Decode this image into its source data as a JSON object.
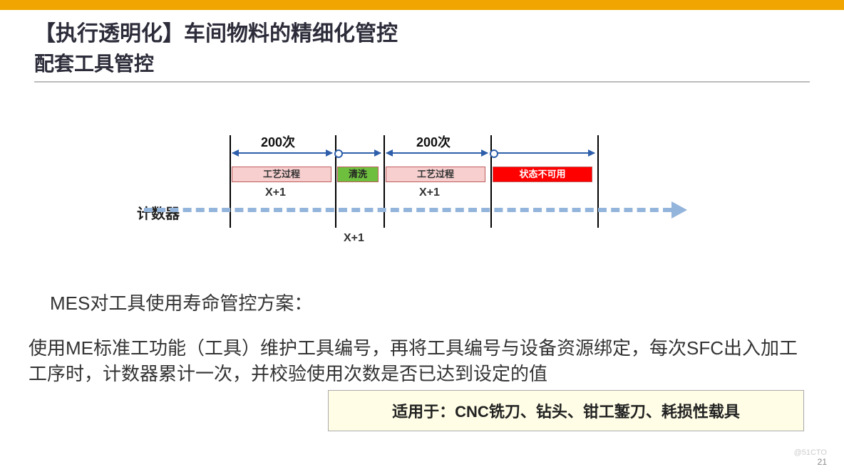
{
  "header": {
    "title_prefix": "【执行透明化】",
    "title_main": "车间物料的精细化管控",
    "subtitle": "配套工具管控"
  },
  "diagram": {
    "counter_label": "计数器",
    "span1_label": "200次",
    "span2_label": "200次",
    "seg_process": "工艺过程",
    "seg_wash": "清洗",
    "seg_unavail": "状态不可用",
    "xplus1": "X+1",
    "xplus2": "X+1",
    "xplus3": "X+1"
  },
  "body": {
    "line1": "MES对工具使用寿命管控方案：",
    "line2": "使用ME标准工功能（工具）维护工具编号，再将工具编号与设备资源绑定，每次SFC出入加工工序时，计数器累计一次，并校验使用次数是否已达到设定的值"
  },
  "callout": "适用于：CNC铣刀、钻头、钳工錾刀、耗损性载具",
  "page_number": "21",
  "watermark": "@51CTO"
}
